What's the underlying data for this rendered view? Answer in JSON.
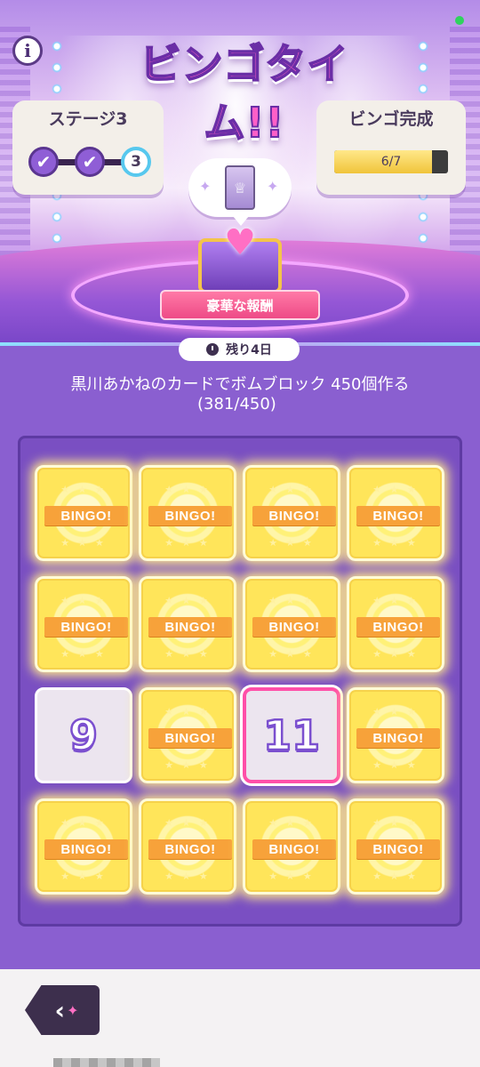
{
  "header": {
    "title": "ビンゴタイム!!",
    "info_label": "i"
  },
  "stage_panel": {
    "title": "ステージ3",
    "nodes": [
      {
        "label": "✔",
        "state": "done"
      },
      {
        "label": "✔",
        "state": "done"
      },
      {
        "label": "3",
        "state": "current"
      }
    ]
  },
  "bingo_panel": {
    "title": "ビンゴ完成",
    "progress_text": "6/7",
    "progress_fraction": 0.857
  },
  "reward": {
    "banner": "豪華な報酬"
  },
  "timer": {
    "text": "残り4日"
  },
  "mission": {
    "description": "黒川あかねのカードでボムブロック 450個作る",
    "count": "(381/450)"
  },
  "board": {
    "bingo_label": "BINGO!",
    "tiles": [
      {
        "type": "bingo",
        "label": "BINGO!"
      },
      {
        "type": "bingo",
        "label": "BINGO!"
      },
      {
        "type": "bingo",
        "label": "BINGO!"
      },
      {
        "type": "bingo",
        "label": "BINGO!"
      },
      {
        "type": "bingo",
        "label": "BINGO!"
      },
      {
        "type": "bingo",
        "label": "BINGO!"
      },
      {
        "type": "bingo",
        "label": "BINGO!"
      },
      {
        "type": "bingo",
        "label": "BINGO!"
      },
      {
        "type": "number",
        "label": "9"
      },
      {
        "type": "bingo",
        "label": "BINGO!"
      },
      {
        "type": "number",
        "label": "11",
        "selected": true
      },
      {
        "type": "bingo",
        "label": "BINGO!"
      },
      {
        "type": "bingo",
        "label": "BINGO!"
      },
      {
        "type": "bingo",
        "label": "BINGO!"
      },
      {
        "type": "bingo",
        "label": "BINGO!"
      },
      {
        "type": "bingo",
        "label": "BINGO!"
      }
    ]
  },
  "colors": {
    "accent_pink": "#ff4fa8",
    "board_purple": "#7a4fc2",
    "bingo_yellow": "#ffe55a",
    "ribbon_orange": "#f7a23a"
  },
  "icons": {
    "info": "info-icon",
    "timer": "clock-icon",
    "back": "back-arrow-icon",
    "check": "check-icon"
  }
}
